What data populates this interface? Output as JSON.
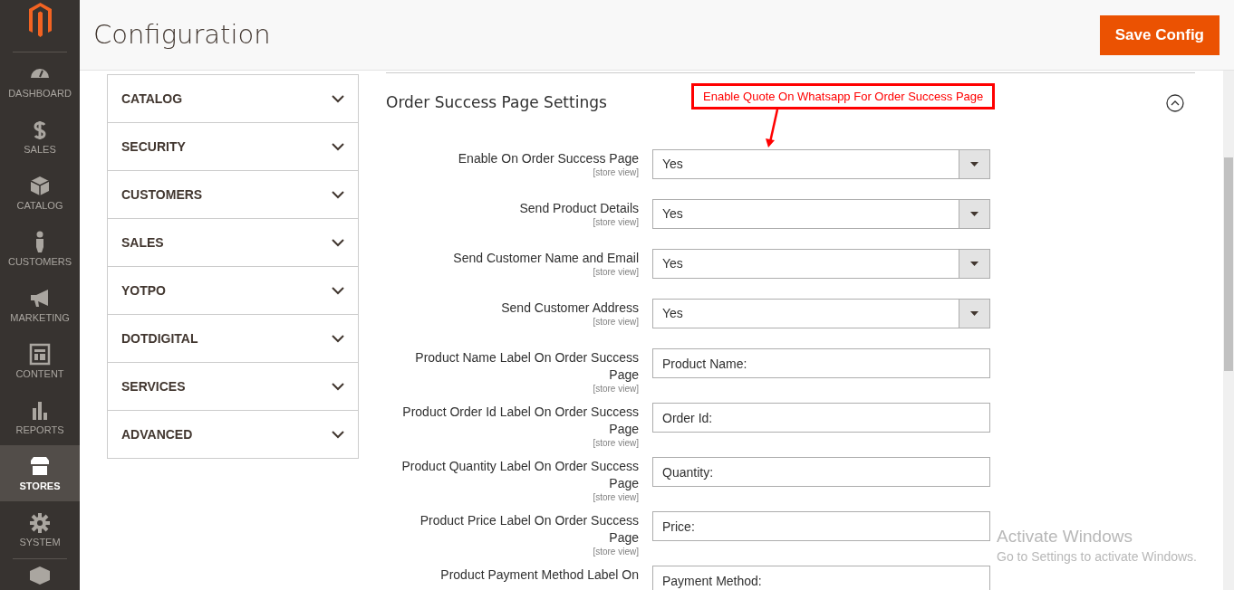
{
  "nav": [
    {
      "label": "DASHBOARD",
      "selected": false
    },
    {
      "label": "SALES",
      "selected": false
    },
    {
      "label": "CATALOG",
      "selected": false
    },
    {
      "label": "CUSTOMERS",
      "selected": false
    },
    {
      "label": "MARKETING",
      "selected": false
    },
    {
      "label": "CONTENT",
      "selected": false
    },
    {
      "label": "REPORTS",
      "selected": false
    },
    {
      "label": "STORES",
      "selected": true
    },
    {
      "label": "SYSTEM",
      "selected": false
    }
  ],
  "header": {
    "title": "Configuration",
    "save_button": "Save Config"
  },
  "config_tabs": [
    {
      "label": "CATALOG",
      "expanded": false
    },
    {
      "label": "SECURITY",
      "expanded": false
    },
    {
      "label": "CUSTOMERS",
      "expanded": false
    },
    {
      "label": "SALES",
      "expanded": false
    },
    {
      "label": "YOTPO",
      "expanded": false
    },
    {
      "label": "DOTDIGITAL",
      "expanded": false
    },
    {
      "label": "SERVICES",
      "expanded": false
    },
    {
      "label": "ADVANCED",
      "expanded": false
    }
  ],
  "section": {
    "title": "Order Success Page Settings",
    "expanded": true,
    "annotation": "Enable Quote On Whatsapp For Order Success Page",
    "fields": [
      {
        "kind": "select",
        "label": "Enable On Order Success Page",
        "scope": "[store view]",
        "value": "Yes"
      },
      {
        "kind": "select",
        "label": "Send Product Details",
        "scope": "[store view]",
        "value": "Yes"
      },
      {
        "kind": "select",
        "label": "Send Customer Name and Email",
        "scope": "[store view]",
        "value": "Yes"
      },
      {
        "kind": "select",
        "label": "Send Customer Address",
        "scope": "[store view]",
        "value": "Yes"
      },
      {
        "kind": "text",
        "label": "Product Name Label On Order Success Page",
        "scope": "[store view]",
        "value": "Product Name:"
      },
      {
        "kind": "text",
        "label": "Product Order Id Label On Order Success Page",
        "scope": "[store view]",
        "value": "Order Id:"
      },
      {
        "kind": "text",
        "label": "Product Quantity Label On Order Success Page",
        "scope": "[store view]",
        "value": "Quantity:"
      },
      {
        "kind": "text",
        "label": "Product Price Label On Order Success Page",
        "scope": "[store view]",
        "value": "Price:"
      },
      {
        "kind": "text",
        "label": "Product Payment Method Label On",
        "value": "Payment Method:"
      }
    ]
  },
  "os_notice": {
    "title": "Activate Windows",
    "text": "Go to Settings to activate Windows."
  }
}
